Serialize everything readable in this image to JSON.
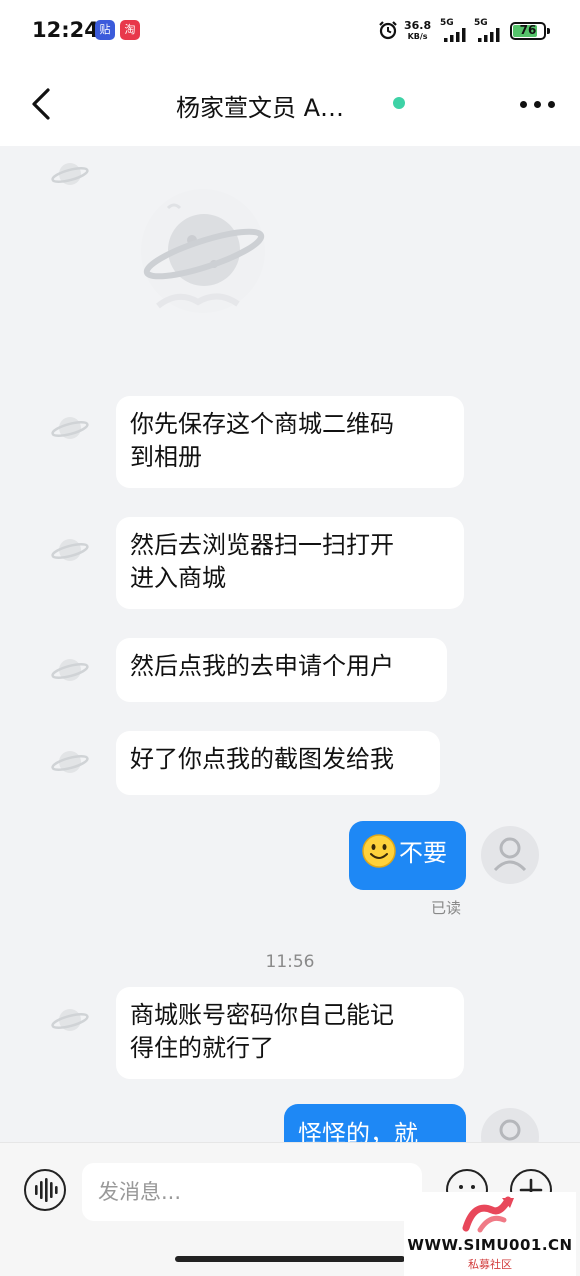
{
  "status_bar": {
    "time": "12:24",
    "app_badges": [
      "贴",
      "淘"
    ],
    "net_speed_value": "36.8",
    "net_speed_unit": "KB/s",
    "signal_labels": [
      "5G",
      "5G"
    ],
    "battery": "76"
  },
  "header": {
    "title": "杨家萱文员 A…",
    "online_color": "#3ed2a6"
  },
  "messages": [
    {
      "from": "them",
      "text": "你先保存这个商城二维码\n到相册"
    },
    {
      "from": "them",
      "text": "然后去浏览器扫一扫打开\n进入商城"
    },
    {
      "from": "them",
      "text": "然后点我的去申请个用户"
    },
    {
      "from": "them",
      "text": "好了你点我的截图发给我"
    },
    {
      "from": "me",
      "text": "不要",
      "emoji": "smiley-face-emoji",
      "status": "已读"
    },
    {
      "from": "them",
      "text": "商城账号密码你自己能记\n得住的就行了"
    },
    {
      "from": "me",
      "text": "怪怪的，就"
    }
  ],
  "timestamp": "11:56",
  "input_bar": {
    "placeholder": "发消息..."
  },
  "watermark": {
    "site": "WWW.SIMU001.CN",
    "subtitle": "私募社区"
  },
  "colors": {
    "accent": "#1e88f5",
    "background": "#f2f3f5",
    "bubble": "#ffffff"
  }
}
